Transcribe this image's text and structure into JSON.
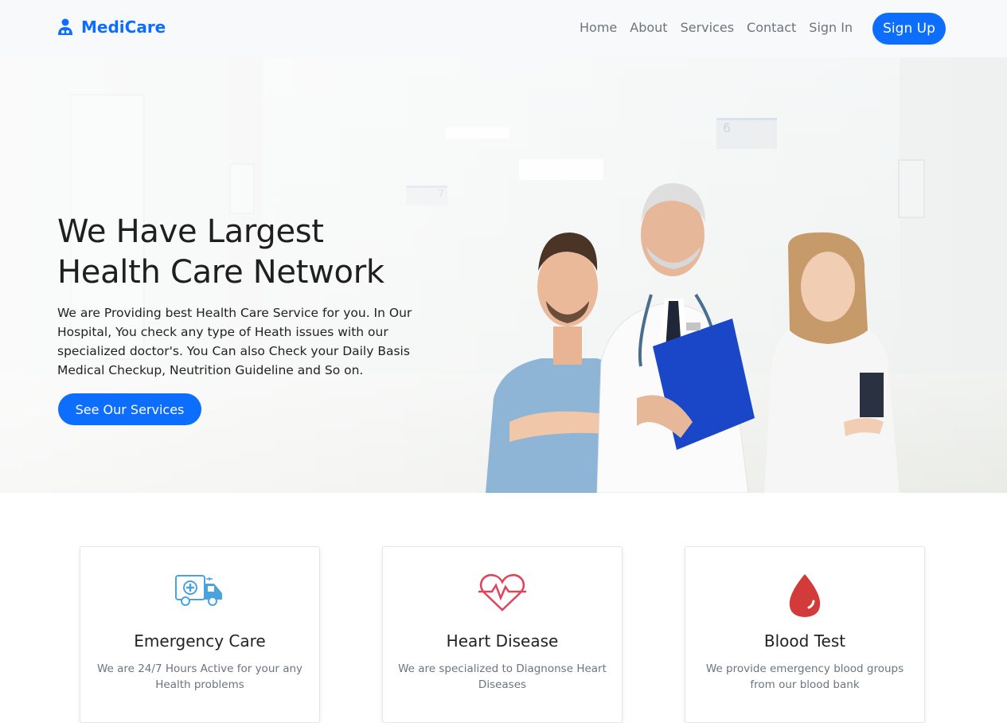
{
  "brand": {
    "name": "MediCare",
    "color": "#0d6efd"
  },
  "nav": {
    "links": [
      "Home",
      "About",
      "Services",
      "Contact",
      "Sign In"
    ],
    "signup_label": "Sign Up"
  },
  "hero": {
    "title_line1": "We Have Largest",
    "title_line2": "Health Care Network",
    "description": "We are Providing best Health Care Service for you. In Our Hospital, You check any type of Heath issues with our specialized doctor's. You Can also Check your Daily Basis Medical Checkup, Neutrition Guideline and So on.",
    "cta_label": "See Our Services",
    "hall_signs": [
      "6",
      "7"
    ]
  },
  "services": [
    {
      "icon": "ambulance-icon",
      "title": "Emergency Care",
      "description": "We are 24/7 Hours Active for your any Health problems",
      "icon_color": "#4aa3df"
    },
    {
      "icon": "heartbeat-icon",
      "title": "Heart Disease",
      "description": "We are specialized to Diagnonse Heart Diseases",
      "icon_color": "#e0445a"
    },
    {
      "icon": "blood-drop-icon",
      "title": "Blood Test",
      "description": "We provide emergency blood groups from our blood bank",
      "icon_color": "#d33a3a"
    }
  ]
}
